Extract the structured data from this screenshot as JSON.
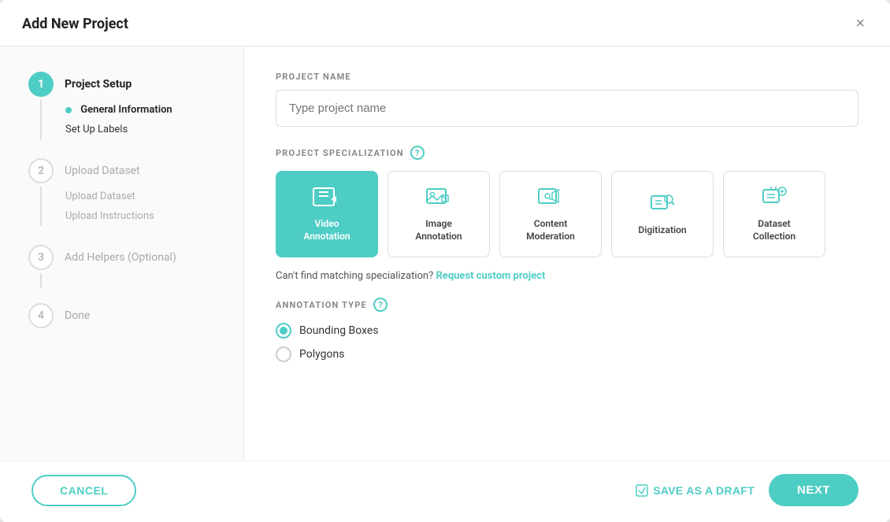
{
  "modal": {
    "title": "Add New Project",
    "close_label": "×"
  },
  "sidebar": {
    "steps": [
      {
        "number": "1",
        "label": "Project Setup",
        "active": true,
        "sub_items": [
          {
            "label": "General Information",
            "active": true
          },
          {
            "label": "Set Up Labels",
            "active": false
          }
        ]
      },
      {
        "number": "2",
        "label": "Upload Dataset",
        "active": false,
        "sub_items": [
          {
            "label": "Upload Dataset",
            "active": false
          },
          {
            "label": "Upload Instructions",
            "active": false
          }
        ]
      },
      {
        "number": "3",
        "label": "Add Helpers (Optional)",
        "active": false,
        "sub_items": []
      },
      {
        "number": "4",
        "label": "Done",
        "active": false,
        "sub_items": []
      }
    ]
  },
  "main": {
    "project_name_label": "PROJECT NAME",
    "project_name_placeholder": "Type project name",
    "specialization_label": "PROJECT SPECIALIZATION",
    "specialization_cards": [
      {
        "id": "video",
        "label": "Video\nAnnotation",
        "selected": true
      },
      {
        "id": "image",
        "label": "Image\nAnnotation",
        "selected": false
      },
      {
        "id": "content",
        "label": "Content\nModeration",
        "selected": false
      },
      {
        "id": "digitization",
        "label": "Digitization",
        "selected": false
      },
      {
        "id": "dataset",
        "label": "Dataset\nCollection",
        "selected": false
      }
    ],
    "custom_link_text": "Can't find matching specialization?",
    "custom_link_label": "Request custom project",
    "annotation_type_label": "ANNOTATION TYPE",
    "annotation_options": [
      {
        "label": "Bounding Boxes",
        "selected": true
      },
      {
        "label": "Polygons",
        "selected": false
      }
    ]
  },
  "footer": {
    "cancel_label": "CANCEL",
    "save_draft_label": "SAVE AS A DRAFT",
    "next_label": "NEXT"
  }
}
